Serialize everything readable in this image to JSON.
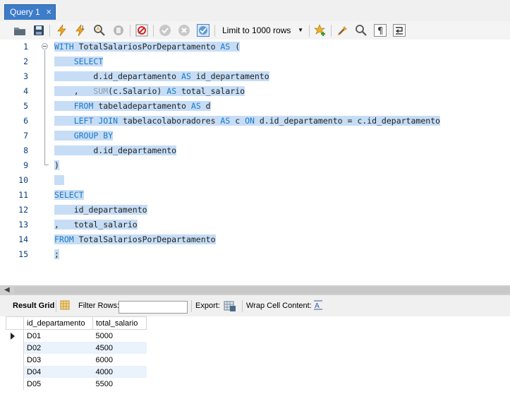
{
  "tab": {
    "label": "Query 1",
    "close": "×"
  },
  "toolbar": {
    "limit_label": "Limit to 1000 rows"
  },
  "editor": {
    "line_numbers": [
      "1",
      "2",
      "3",
      "4",
      "5",
      "6",
      "7",
      "8",
      "9",
      "10",
      "11",
      "12",
      "13",
      "14",
      "15"
    ],
    "lines": [
      [
        {
          "t": "WITH",
          "c": "kw"
        },
        {
          "t": " TotalSalariosPorDepartamento ",
          "c": "tx"
        },
        {
          "t": "AS",
          "c": "kw"
        },
        {
          "t": " (",
          "c": "tx"
        }
      ],
      [
        {
          "t": "    ",
          "c": "tx"
        },
        {
          "t": "SELECT",
          "c": "kw"
        }
      ],
      [
        {
          "t": "        d.id_departamento ",
          "c": "tx"
        },
        {
          "t": "AS",
          "c": "kw"
        },
        {
          "t": " id_departamento",
          "c": "tx"
        }
      ],
      [
        {
          "t": "    ,   ",
          "c": "tx"
        },
        {
          "t": "SUM",
          "c": "fn"
        },
        {
          "t": "(c.Salario) ",
          "c": "tx"
        },
        {
          "t": "AS",
          "c": "kw"
        },
        {
          "t": " total_salario",
          "c": "tx"
        }
      ],
      [
        {
          "t": "    ",
          "c": "tx"
        },
        {
          "t": "FROM",
          "c": "kw"
        },
        {
          "t": " tabeladepartamento ",
          "c": "tx"
        },
        {
          "t": "AS",
          "c": "kw"
        },
        {
          "t": " d",
          "c": "tx"
        }
      ],
      [
        {
          "t": "    ",
          "c": "tx"
        },
        {
          "t": "LEFT JOIN",
          "c": "kw"
        },
        {
          "t": " tabelacolaboradores ",
          "c": "tx"
        },
        {
          "t": "AS",
          "c": "kw"
        },
        {
          "t": " c ",
          "c": "tx"
        },
        {
          "t": "ON",
          "c": "kw"
        },
        {
          "t": " d.id_departamento = c.id_departamento",
          "c": "tx"
        }
      ],
      [
        {
          "t": "    ",
          "c": "tx"
        },
        {
          "t": "GROUP BY",
          "c": "kw"
        }
      ],
      [
        {
          "t": "        d.id_departamento",
          "c": "tx"
        }
      ],
      [
        {
          "t": ")",
          "c": "tx"
        }
      ],
      [
        {
          "t": "  ",
          "c": "tx"
        }
      ],
      [
        {
          "t": "SELECT",
          "c": "kw"
        }
      ],
      [
        {
          "t": "    id_departamento",
          "c": "tx"
        }
      ],
      [
        {
          "t": ",   total_salario",
          "c": "tx"
        }
      ],
      [
        {
          "t": "FROM",
          "c": "kw"
        },
        {
          "t": " TotalSalariosPorDepartamento",
          "c": "tx"
        }
      ],
      [
        {
          "t": ";",
          "c": "tx"
        }
      ]
    ]
  },
  "result_bar": {
    "result_grid": "Result Grid",
    "filter_rows": "Filter Rows:",
    "export": "Export:",
    "wrap": "Wrap Cell Content:"
  },
  "grid": {
    "columns": [
      "id_departamento",
      "total_salario"
    ],
    "rows": [
      [
        "D01",
        "5000"
      ],
      [
        "D02",
        "4500"
      ],
      [
        "D03",
        "6000"
      ],
      [
        "D04",
        "4000"
      ],
      [
        "D05",
        "5500"
      ]
    ]
  },
  "icons": [
    "open-file-icon",
    "save-icon",
    "execute-icon",
    "execute-current-icon",
    "explain-icon",
    "stop-icon",
    "toggle-error-icon",
    "commit-icon",
    "rollback-icon",
    "autocommit-icon",
    "beautify-icon",
    "favorite-icon",
    "clear-icon",
    "find-icon",
    "invisible-chars-icon",
    "wrap-icon",
    "result-grid-icon",
    "export-icon",
    "wrap-cell-icon"
  ],
  "colors": {
    "tab": "#3d7cc9",
    "keyword": "#1c78c8",
    "selection": "#c6ddf5",
    "line_number": "#0b3f78"
  }
}
